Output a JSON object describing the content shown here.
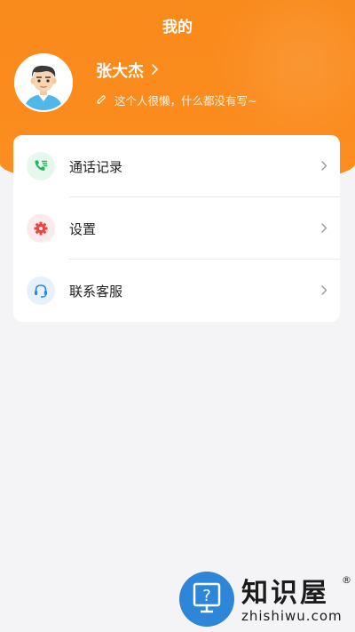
{
  "header": {
    "title": "我的"
  },
  "profile": {
    "avatar_icon": "user-avatar-icon",
    "name": "张大杰",
    "bio": "这个人很懒，什么都没有写~"
  },
  "menu": {
    "items": [
      {
        "label": "通话记录",
        "icon": "call-log-icon",
        "icon_color": "#22b45e",
        "icon_bg": "#e6f7ec"
      },
      {
        "label": "设置",
        "icon": "settings-gear-icon",
        "icon_color": "#ee4343",
        "icon_bg": "#fdeaea"
      },
      {
        "label": "联系客服",
        "icon": "headset-icon",
        "icon_color": "#2c88df",
        "icon_bg": "#e7f1fc"
      }
    ]
  },
  "watermark": {
    "title": "知识屋",
    "reg_mark": "®",
    "url": "zhishiwu.com"
  },
  "colors": {
    "accent": "#fb8b1d",
    "background": "#f4f4f6"
  }
}
